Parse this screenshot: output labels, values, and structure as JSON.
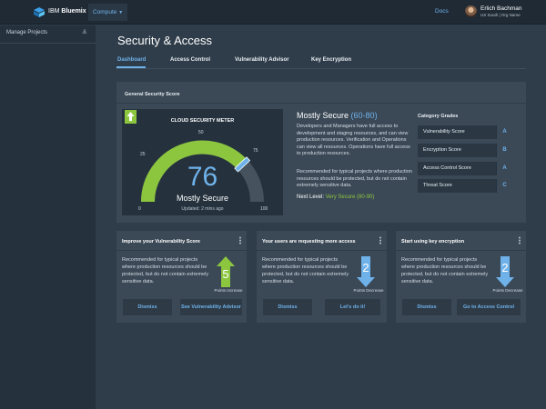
{
  "header": {
    "brand_prefix": "IBM",
    "brand_name": "Bluemix",
    "compute_label": "Compute",
    "docs_label": "Docs",
    "user_name": "Erlich Bachman",
    "user_region": "US South | Org Name"
  },
  "sidebar": {
    "manage_label": "Manage Projects"
  },
  "page": {
    "title": "Security & Access"
  },
  "tabs": [
    {
      "label": "Dashboard",
      "active": true
    },
    {
      "label": "Access Control",
      "active": false
    },
    {
      "label": "Vulnerability Advisor",
      "active": false
    },
    {
      "label": "Key Encryption",
      "active": false
    }
  ],
  "score_panel": {
    "title": "General Security Score",
    "meter": {
      "title": "CLOUD SECURITY METER",
      "value": "76",
      "status": "Mostly Secure",
      "updated": "Updated: 2 mins ago",
      "ticks": {
        "t0": "0",
        "t25": "25",
        "t50": "50",
        "t75": "75",
        "t100": "100"
      },
      "level_fraction": 0.76,
      "colors": {
        "fill": "#8cc63f",
        "track": "#46535f",
        "pointer": "#6fb2ea"
      }
    },
    "headline": "Mostly Secure",
    "headline_range": "(60-80)",
    "desc1": "Developers and Managers have full access to development and staging resources, and can view production resources. Verification and Operations can view all resources. Operations have full access to production resources.",
    "desc2": "Recommended for typical projects where production resources should be protected, but do not contain extremely sensitive data.",
    "next_label": "Next Level:",
    "next_value": "Very Secure (80-90)",
    "grades_title": "Category Grades",
    "grades": [
      {
        "label": "Vulnerability Score",
        "grade": "A"
      },
      {
        "label": "Encryption Score",
        "grade": "B"
      },
      {
        "label": "Access Control Score",
        "grade": "A"
      },
      {
        "label": "Threat Score",
        "grade": "C"
      }
    ]
  },
  "cards": [
    {
      "title": "Improve your Vulnerability Score",
      "body": "Recommended for typical projects where production resources should be protected, but do not contain extremely sensitive data.",
      "points": "5",
      "points_label": "Points Increase",
      "direction": "up",
      "color": "#8cc63f",
      "dismiss": "Dismiss",
      "action": "See Vulnerability Advisor"
    },
    {
      "title": "Your users are requesting more access",
      "body": "Recommended for typical projects where production resources should be protected, but do not contain extremely sensitive data.",
      "points": "2",
      "points_label": "Points Decrease",
      "direction": "down",
      "color": "#6fb2ea",
      "dismiss": "Dismiss",
      "action": "Let's do it!"
    },
    {
      "title": "Start using key encryption",
      "body": "Recommended for typical projects where production resources should be protected, but do not contain extremely sensitive data.",
      "points": "2",
      "points_label": "Points Decrease",
      "direction": "down",
      "color": "#6fb2ea",
      "dismiss": "Dismiss",
      "action": "Go to Access Control"
    }
  ],
  "icons": {
    "logo": "bluemix-logo-icon",
    "compute_caret": "caret-down-icon",
    "sidebar_toggle": "double-chevron-icon",
    "card_menu": "overflow-menu-icon",
    "score_up": "arrow-up-icon",
    "points_up": "arrow-up-icon",
    "points_down": "arrow-down-icon"
  }
}
